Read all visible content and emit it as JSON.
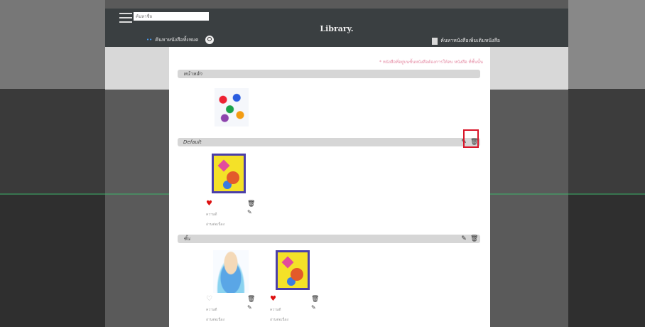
{
  "topbar": {
    "search_placeholder": "ค้นหาชื่อ",
    "title": "Library.",
    "search_all_label": "ค้นหาหนังสือทั้งหมด",
    "request_label": "ค้นหาหนังสือเพิ่มเติมหนังสือ"
  },
  "note": "* หนังสือที่อยู่บนชั้นหนังสือต้องการให้ลบ หนังสือ ที่ชั้นนั้น",
  "shelves": [
    {
      "name": "หน้าหลัก"
    },
    {
      "name": "Default"
    },
    {
      "name": "ชั้น"
    }
  ],
  "books": {
    "default_1": {
      "caption_a": "ความดี",
      "caption_b": "อ่านต่อเนื่อง"
    },
    "shelf3_1": {
      "caption_a": "ความดี",
      "caption_b": "อ่านต่อเนื่อง"
    },
    "shelf3_2": {
      "caption_a": "ความดี",
      "caption_b": "อ่านต่อเนื่อง"
    }
  },
  "icons": {
    "menu": "hamburger-icon",
    "search": "magnifier-icon",
    "edit": "pencil-icon",
    "delete": "trash-icon",
    "favorite": "heart-icon"
  },
  "colors": {
    "topbar": "#3a3f41",
    "highlight": "#d9162a",
    "favorite": "#dd1111",
    "note": "#e58aa3"
  }
}
